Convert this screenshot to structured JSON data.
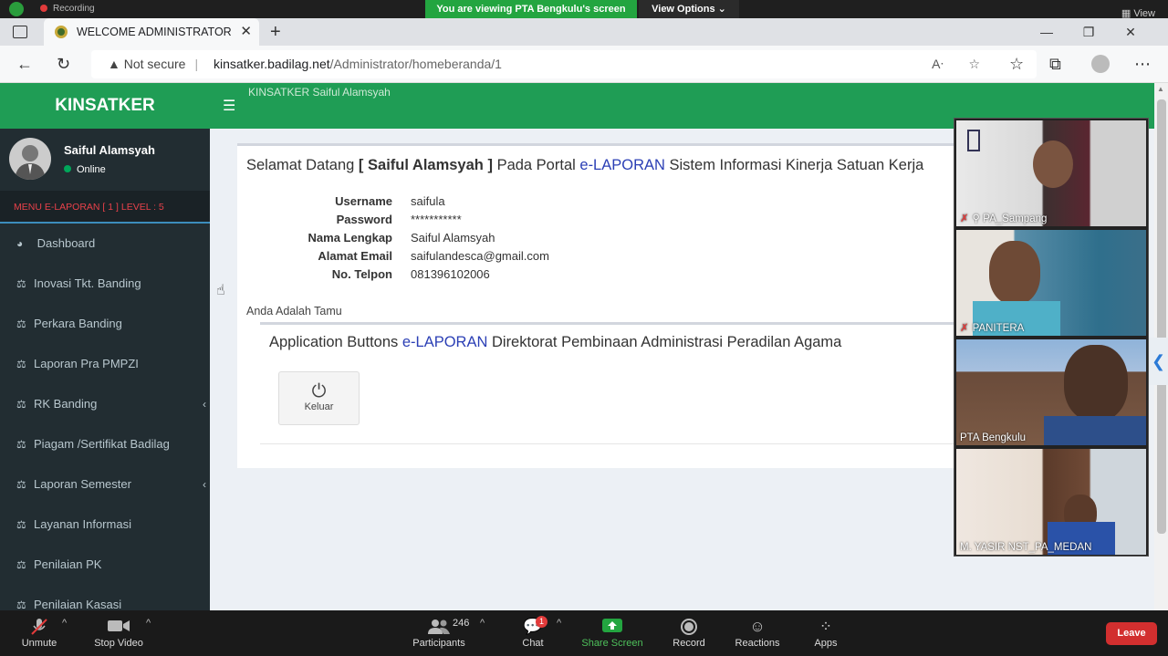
{
  "zoom_top": {
    "recording_label": "Recording",
    "viewing_banner": "You are viewing PTA Bengkulu's screen",
    "view_options": "View Options ⌄",
    "view_label": "View"
  },
  "browser": {
    "tab_title": "WELCOME ADMINISTRATOR",
    "not_secure": "Not secure",
    "url_host": "kinsatker.badilag.net",
    "url_path": "/Administrator/homeberanda/1"
  },
  "sidebar": {
    "logo": "KINSATKER",
    "user_name": "Saiful Alamsyah",
    "status": "Online",
    "menu_header": "MENU E-LAPORAN [ 1 ] LEVEL : 5",
    "items": [
      {
        "label": "Dashboard",
        "icon": "dashboard-icon"
      },
      {
        "label": "Inovasi Tkt. Banding",
        "icon": "balance-scale-icon"
      },
      {
        "label": "Perkara Banding",
        "icon": "balance-scale-icon"
      },
      {
        "label": "Laporan Pra PMPZI",
        "icon": "balance-scale-icon"
      },
      {
        "label": "RK Banding",
        "icon": "balance-scale-icon"
      },
      {
        "label": "Piagam /Sertifikat Badilag",
        "icon": "balance-scale-icon"
      },
      {
        "label": "Laporan Semester",
        "icon": "balance-scale-icon"
      },
      {
        "label": "Layanan Informasi",
        "icon": "balance-scale-icon"
      },
      {
        "label": "Penilaian PK",
        "icon": "balance-scale-icon"
      },
      {
        "label": "Penilaian Kasasi",
        "icon": "balance-scale-icon"
      }
    ]
  },
  "header": {
    "title": "KINSATKER Saiful Alamsyah"
  },
  "welcome": {
    "prefix": "Selamat Datang",
    "bracket_open": "[",
    "name": "Saiful Alamsyah",
    "bracket_close": "]",
    "mid": "Pada Portal",
    "brand": "e-LAPORAN",
    "suffix": "Sistem Informasi Kinerja Satuan Kerja"
  },
  "profile": {
    "fields": [
      {
        "label": "Username",
        "value": "saifula"
      },
      {
        "label": "Password",
        "value": "***********"
      },
      {
        "label": "Nama Lengkap",
        "value": "Saiful Alamsyah"
      },
      {
        "label": "Alamat Email",
        "value": "saifulandesca@gmail.com"
      },
      {
        "label": "No. Telpon",
        "value": "081396102006"
      }
    ],
    "guest_note": "Anda Adalah Tamu"
  },
  "app_buttons": {
    "title_prefix": "Application Buttons",
    "brand": "e-LAPORAN",
    "title_suffix": "Direktorat Pembinaan Administrasi Peradilan Agama",
    "logout_label": "Keluar"
  },
  "video_participants": [
    {
      "name": "PA_Sampang"
    },
    {
      "name": "PANITERA"
    },
    {
      "name": "PTA Bengkulu"
    },
    {
      "name": "M. YASIR NST_PA_MEDAN"
    }
  ],
  "zoom_bottom": {
    "unmute": "Unmute",
    "stop_video": "Stop Video",
    "participants": "Participants",
    "participant_count": "246",
    "chat": "Chat",
    "chat_badge": "1",
    "share_screen": "Share Screen",
    "record": "Record",
    "reactions": "Reactions",
    "apps": "Apps",
    "leave": "Leave"
  }
}
